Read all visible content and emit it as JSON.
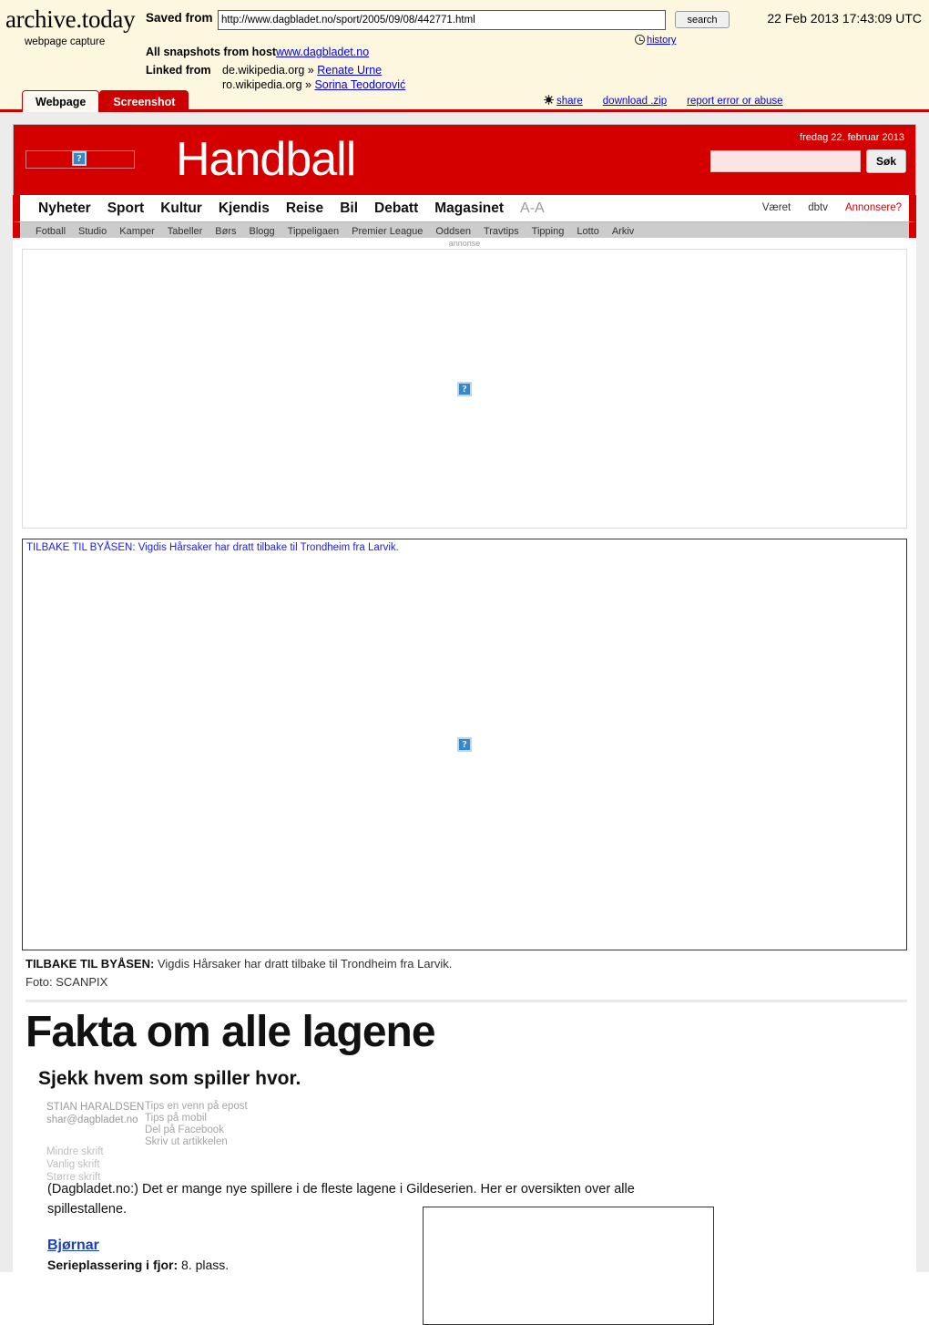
{
  "archive": {
    "logo": "archive.today",
    "logo_sub": "webpage capture",
    "saved_from_label": "Saved from",
    "saved_url": "http://www.dagbladet.no/sport/2005/09/08/442771.html",
    "search_button": "search",
    "timestamp": "22 Feb 2013 17:43:09 UTC",
    "history_link": "history",
    "all_snapshots_label": "All snapshots  from host",
    "all_snapshots_host": "www.dagbladet.no",
    "linked_from_label": "Linked from",
    "linked_rows": [
      {
        "site": "de.wikipedia.org »",
        "title": "Renate Urne"
      },
      {
        "site": "ro.wikipedia.org »",
        "title": "Sorina Teodorović"
      }
    ],
    "tabs": [
      {
        "label": "Webpage",
        "active": true
      },
      {
        "label": "Screenshot",
        "active": false
      }
    ],
    "actions": [
      {
        "label": "share"
      },
      {
        "label": "download .zip"
      },
      {
        "label": "report error or abuse"
      }
    ],
    "accent": "#cc0000",
    "background": "#fdf7e0"
  },
  "site": {
    "brand_color": "#d40000",
    "logo_alt": "?",
    "title": "Handball",
    "date": "fredag 22. februar 2013",
    "search_placeholder": "",
    "search_value": "",
    "search_button": "Søk",
    "nav_main": [
      "Nyheter",
      "Sport",
      "Kultur",
      "Kjendis",
      "Reise",
      "Bil",
      "Debatt",
      "Magasinet"
    ],
    "nav_font_toggle": "A-A",
    "nav_right": [
      {
        "label": "Været",
        "highlight": false
      },
      {
        "label": "dbtv",
        "highlight": false
      },
      {
        "label": "Annonsere?",
        "highlight": true
      }
    ],
    "nav_sub": [
      "Fotball",
      "Studio",
      "Kamper",
      "Tabeller",
      "Børs",
      "Blogg",
      "Tippeligaen",
      "Premier League",
      "Oddsen",
      "Travtips",
      "Tipping",
      "Lotto",
      "Arkiv"
    ]
  },
  "ad": {
    "label": "annonse",
    "broken_image_glyph": "?"
  },
  "photo": {
    "alt_text": "TILBAKE TIL BYÅSEN: Vigdis Hårsaker har dratt tilbake til Trondheim fra Larvik.",
    "broken_image_glyph": "?",
    "caption_lead": "TILBAKE TIL BYÅSEN:",
    "caption_rest": " Vigdis Hårsaker har dratt tilbake til Trondheim fra Larvik.",
    "credit": "Foto: SCANPIX"
  },
  "article": {
    "headline": "Fakta om alle lagene",
    "subhead": "Sjekk hvem som spiller hvor.",
    "author_name": "STIAN HARALDSEN",
    "author_email": "shar@dagbladet.no",
    "tools": [
      "Tips en venn på epost",
      "Tips på mobil",
      "Del på Facebook",
      "Skriv ut artikkelen"
    ],
    "font_sizes": [
      "Mindre skrift",
      "Vanlig skrift",
      "Større skrift"
    ],
    "lede": "(Dagbladet.no:) Det er mange nye spillere i de fleste lagene i Gildeserien. Her er oversikten over alle spillestallene.",
    "team_link": "Bjørnar",
    "fact_label": "Serieplassering i fjor:",
    "fact_value": " 8. plass."
  }
}
